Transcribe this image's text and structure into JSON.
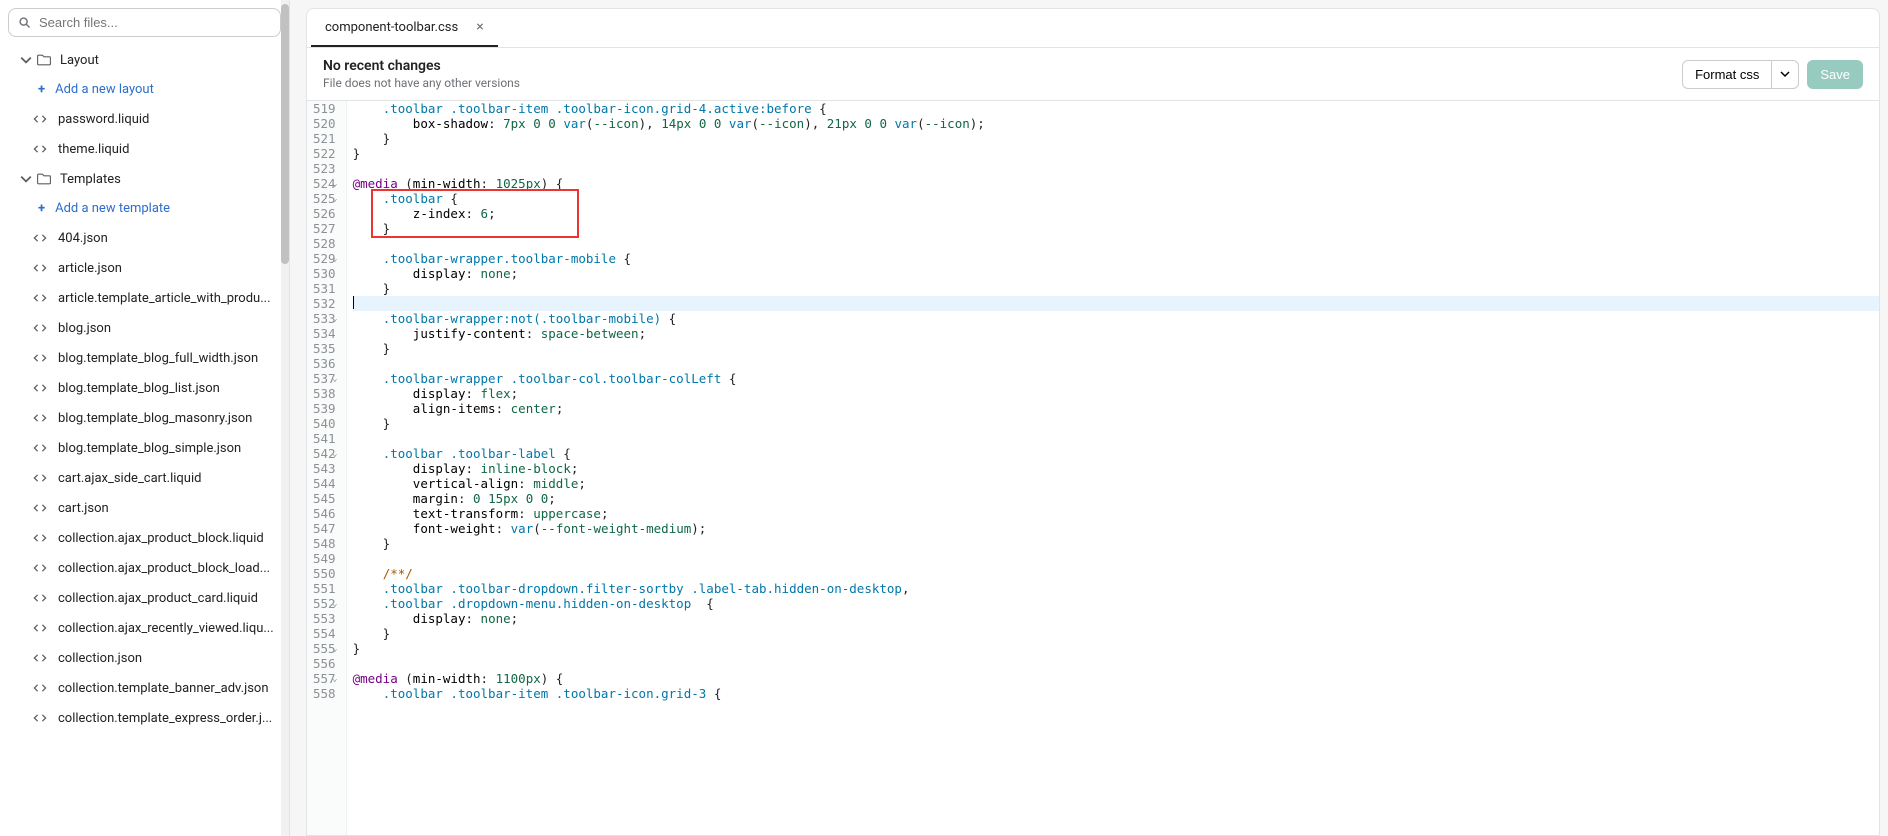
{
  "search": {
    "placeholder": "Search files..."
  },
  "tree": {
    "sections": [
      {
        "label": "Layout",
        "addLabel": "Add a new layout",
        "items": [
          "password.liquid",
          "theme.liquid"
        ]
      },
      {
        "label": "Templates",
        "addLabel": "Add a new template",
        "items": [
          "404.json",
          "article.json",
          "article.template_article_with_produ...",
          "blog.json",
          "blog.template_blog_full_width.json",
          "blog.template_blog_list.json",
          "blog.template_blog_masonry.json",
          "blog.template_blog_simple.json",
          "cart.ajax_side_cart.liquid",
          "cart.json",
          "collection.ajax_product_block.liquid",
          "collection.ajax_product_block_load...",
          "collection.ajax_product_card.liquid",
          "collection.ajax_recently_viewed.liqu...",
          "collection.json",
          "collection.template_banner_adv.json",
          "collection.template_express_order.j..."
        ]
      }
    ]
  },
  "tabs": [
    {
      "name": "component-toolbar.css",
      "active": true
    }
  ],
  "info": {
    "title": "No recent changes",
    "subtitle": "File does not have any other versions"
  },
  "buttons": {
    "format": "Format css",
    "save": "Save"
  },
  "editor": {
    "startLine": 519,
    "cursorLine": 532,
    "highlight": {
      "from": 525,
      "to": 527,
      "leftPx": 24,
      "widthPx": 208
    },
    "lines": [
      {
        "n": 519,
        "raw": "    .toolbar .toolbar-item .toolbar-icon.grid-4.active:before {",
        "tokens": [
          [
            "    ",
            "p"
          ],
          [
            ".toolbar .toolbar-item .toolbar-icon.grid-4.active:before",
            "sel"
          ],
          [
            " {",
            "p"
          ]
        ]
      },
      {
        "n": 520,
        "raw": "        box-shadow: 7px 0 0 var(--icon), 14px 0 0 var(--icon), 21px 0 0 var(--icon);",
        "tokens": [
          [
            "        ",
            "p"
          ],
          [
            "box-shadow",
            "prop"
          ],
          [
            ": ",
            "p"
          ],
          [
            "7px 0 0 ",
            "num"
          ],
          [
            "var",
            "func"
          ],
          [
            "(",
            "p"
          ],
          [
            "--icon",
            "val"
          ],
          [
            "), ",
            "p"
          ],
          [
            "14px 0 0 ",
            "num"
          ],
          [
            "var",
            "func"
          ],
          [
            "(",
            "p"
          ],
          [
            "--icon",
            "val"
          ],
          [
            "), ",
            "p"
          ],
          [
            "21px 0 0 ",
            "num"
          ],
          [
            "var",
            "func"
          ],
          [
            "(",
            "p"
          ],
          [
            "--icon",
            "val"
          ],
          [
            ");",
            "p"
          ]
        ]
      },
      {
        "n": 521,
        "raw": "    }",
        "tokens": [
          [
            "    }",
            "p"
          ]
        ]
      },
      {
        "n": 522,
        "raw": "}",
        "tokens": [
          [
            "}",
            "p"
          ]
        ]
      },
      {
        "n": 523,
        "raw": "",
        "tokens": []
      },
      {
        "n": 524,
        "fold": true,
        "raw": "@media (min-width: 1025px) {",
        "tokens": [
          [
            "@media",
            "media"
          ],
          [
            " (",
            "p"
          ],
          [
            "min-width",
            "prop"
          ],
          [
            ": ",
            "p"
          ],
          [
            "1025px",
            "num"
          ],
          [
            ") {",
            "p"
          ]
        ]
      },
      {
        "n": 525,
        "fold": true,
        "raw": "    .toolbar {",
        "tokens": [
          [
            "    ",
            "p"
          ],
          [
            ".toolbar",
            "sel"
          ],
          [
            " {",
            "p"
          ]
        ]
      },
      {
        "n": 526,
        "raw": "        z-index: 6;",
        "tokens": [
          [
            "        ",
            "p"
          ],
          [
            "z-index",
            "prop"
          ],
          [
            ": ",
            "p"
          ],
          [
            "6",
            "num"
          ],
          [
            ";",
            "p"
          ]
        ]
      },
      {
        "n": 527,
        "raw": "    }",
        "tokens": [
          [
            "    }",
            "p"
          ]
        ]
      },
      {
        "n": 528,
        "raw": "",
        "tokens": []
      },
      {
        "n": 529,
        "fold": true,
        "raw": "    .toolbar-wrapper.toolbar-mobile {",
        "tokens": [
          [
            "    ",
            "p"
          ],
          [
            ".toolbar-wrapper.toolbar-mobile",
            "sel"
          ],
          [
            " {",
            "p"
          ]
        ]
      },
      {
        "n": 530,
        "raw": "        display: none;",
        "tokens": [
          [
            "        ",
            "p"
          ],
          [
            "display",
            "prop"
          ],
          [
            ": ",
            "p"
          ],
          [
            "none",
            "val"
          ],
          [
            ";",
            "p"
          ]
        ]
      },
      {
        "n": 531,
        "raw": "    }",
        "tokens": [
          [
            "    }",
            "p"
          ]
        ]
      },
      {
        "n": 532,
        "raw": "",
        "tokens": []
      },
      {
        "n": 533,
        "fold": true,
        "raw": "    .toolbar-wrapper:not(.toolbar-mobile) {",
        "tokens": [
          [
            "    ",
            "p"
          ],
          [
            ".toolbar-wrapper:not(.toolbar-mobile)",
            "sel"
          ],
          [
            " {",
            "p"
          ]
        ]
      },
      {
        "n": 534,
        "raw": "        justify-content: space-between;",
        "tokens": [
          [
            "        ",
            "p"
          ],
          [
            "justify-content",
            "prop"
          ],
          [
            ": ",
            "p"
          ],
          [
            "space-between",
            "val"
          ],
          [
            ";",
            "p"
          ]
        ]
      },
      {
        "n": 535,
        "raw": "    }",
        "tokens": [
          [
            "    }",
            "p"
          ]
        ]
      },
      {
        "n": 536,
        "raw": "",
        "tokens": []
      },
      {
        "n": 537,
        "fold": true,
        "raw": "    .toolbar-wrapper .toolbar-col.toolbar-colLeft {",
        "tokens": [
          [
            "    ",
            "p"
          ],
          [
            ".toolbar-wrapper .toolbar-col.toolbar-colLeft",
            "sel"
          ],
          [
            " {",
            "p"
          ]
        ]
      },
      {
        "n": 538,
        "raw": "        display: flex;",
        "tokens": [
          [
            "        ",
            "p"
          ],
          [
            "display",
            "prop"
          ],
          [
            ": ",
            "p"
          ],
          [
            "flex",
            "val"
          ],
          [
            ";",
            "p"
          ]
        ]
      },
      {
        "n": 539,
        "raw": "        align-items: center;",
        "tokens": [
          [
            "        ",
            "p"
          ],
          [
            "align-items",
            "prop"
          ],
          [
            ": ",
            "p"
          ],
          [
            "center",
            "val"
          ],
          [
            ";",
            "p"
          ]
        ]
      },
      {
        "n": 540,
        "raw": "    }",
        "tokens": [
          [
            "    }",
            "p"
          ]
        ]
      },
      {
        "n": 541,
        "raw": "",
        "tokens": []
      },
      {
        "n": 542,
        "fold": true,
        "raw": "    .toolbar .toolbar-label {",
        "tokens": [
          [
            "    ",
            "p"
          ],
          [
            ".toolbar .toolbar-label",
            "sel"
          ],
          [
            " {",
            "p"
          ]
        ]
      },
      {
        "n": 543,
        "raw": "        display: inline-block;",
        "tokens": [
          [
            "        ",
            "p"
          ],
          [
            "display",
            "prop"
          ],
          [
            ": ",
            "p"
          ],
          [
            "inline-block",
            "val"
          ],
          [
            ";",
            "p"
          ]
        ]
      },
      {
        "n": 544,
        "raw": "        vertical-align: middle;",
        "tokens": [
          [
            "        ",
            "p"
          ],
          [
            "vertical-align",
            "prop"
          ],
          [
            ": ",
            "p"
          ],
          [
            "middle",
            "val"
          ],
          [
            ";",
            "p"
          ]
        ]
      },
      {
        "n": 545,
        "raw": "        margin: 0 15px 0 0;",
        "tokens": [
          [
            "        ",
            "p"
          ],
          [
            "margin",
            "prop"
          ],
          [
            ": ",
            "p"
          ],
          [
            "0 15px 0 0",
            "num"
          ],
          [
            ";",
            "p"
          ]
        ]
      },
      {
        "n": 546,
        "raw": "        text-transform: uppercase;",
        "tokens": [
          [
            "        ",
            "p"
          ],
          [
            "text-transform",
            "prop"
          ],
          [
            ": ",
            "p"
          ],
          [
            "uppercase",
            "val"
          ],
          [
            ";",
            "p"
          ]
        ]
      },
      {
        "n": 547,
        "raw": "        font-weight: var(--font-weight-medium);",
        "tokens": [
          [
            "        ",
            "p"
          ],
          [
            "font-weight",
            "prop"
          ],
          [
            ": ",
            "p"
          ],
          [
            "var",
            "func"
          ],
          [
            "(",
            "p"
          ],
          [
            "--font-weight-medium",
            "val"
          ],
          [
            ");",
            "p"
          ]
        ]
      },
      {
        "n": 548,
        "raw": "    }",
        "tokens": [
          [
            "    }",
            "p"
          ]
        ]
      },
      {
        "n": 549,
        "raw": "",
        "tokens": []
      },
      {
        "n": 550,
        "raw": "    /**/",
        "tokens": [
          [
            "    ",
            "p"
          ],
          [
            "/**/",
            "comment"
          ]
        ]
      },
      {
        "n": 551,
        "raw": "    .toolbar .toolbar-dropdown.filter-sortby .label-tab.hidden-on-desktop,",
        "tokens": [
          [
            "    ",
            "p"
          ],
          [
            ".toolbar .toolbar-dropdown.filter-sortby .label-tab.hidden-on-desktop",
            "sel"
          ],
          [
            ",",
            "p"
          ]
        ]
      },
      {
        "n": 552,
        "fold": true,
        "raw": "    .toolbar .dropdown-menu.hidden-on-desktop  {",
        "tokens": [
          [
            "    ",
            "p"
          ],
          [
            ".toolbar .dropdown-menu.hidden-on-desktop",
            "sel"
          ],
          [
            "  {",
            "p"
          ]
        ]
      },
      {
        "n": 553,
        "raw": "        display: none;",
        "tokens": [
          [
            "        ",
            "p"
          ],
          [
            "display",
            "prop"
          ],
          [
            ": ",
            "p"
          ],
          [
            "none",
            "val"
          ],
          [
            ";",
            "p"
          ]
        ]
      },
      {
        "n": 554,
        "raw": "    }",
        "tokens": [
          [
            "    }",
            "p"
          ]
        ]
      },
      {
        "n": 555,
        "fold": true,
        "raw": "}",
        "tokens": [
          [
            "}",
            "p"
          ]
        ]
      },
      {
        "n": 556,
        "raw": "",
        "tokens": []
      },
      {
        "n": 557,
        "fold": true,
        "raw": "@media (min-width: 1100px) {",
        "tokens": [
          [
            "@media",
            "media"
          ],
          [
            " (",
            "p"
          ],
          [
            "min-width",
            "prop"
          ],
          [
            ": ",
            "p"
          ],
          [
            "1100px",
            "num"
          ],
          [
            ") {",
            "p"
          ]
        ]
      },
      {
        "n": 558,
        "raw": "    .toolbar .toolbar-item .toolbar-icon.grid-3 {",
        "tokens": [
          [
            "    ",
            "p"
          ],
          [
            ".toolbar .toolbar-item .toolbar-icon.grid-3",
            "sel"
          ],
          [
            " {",
            "p"
          ]
        ]
      }
    ]
  }
}
